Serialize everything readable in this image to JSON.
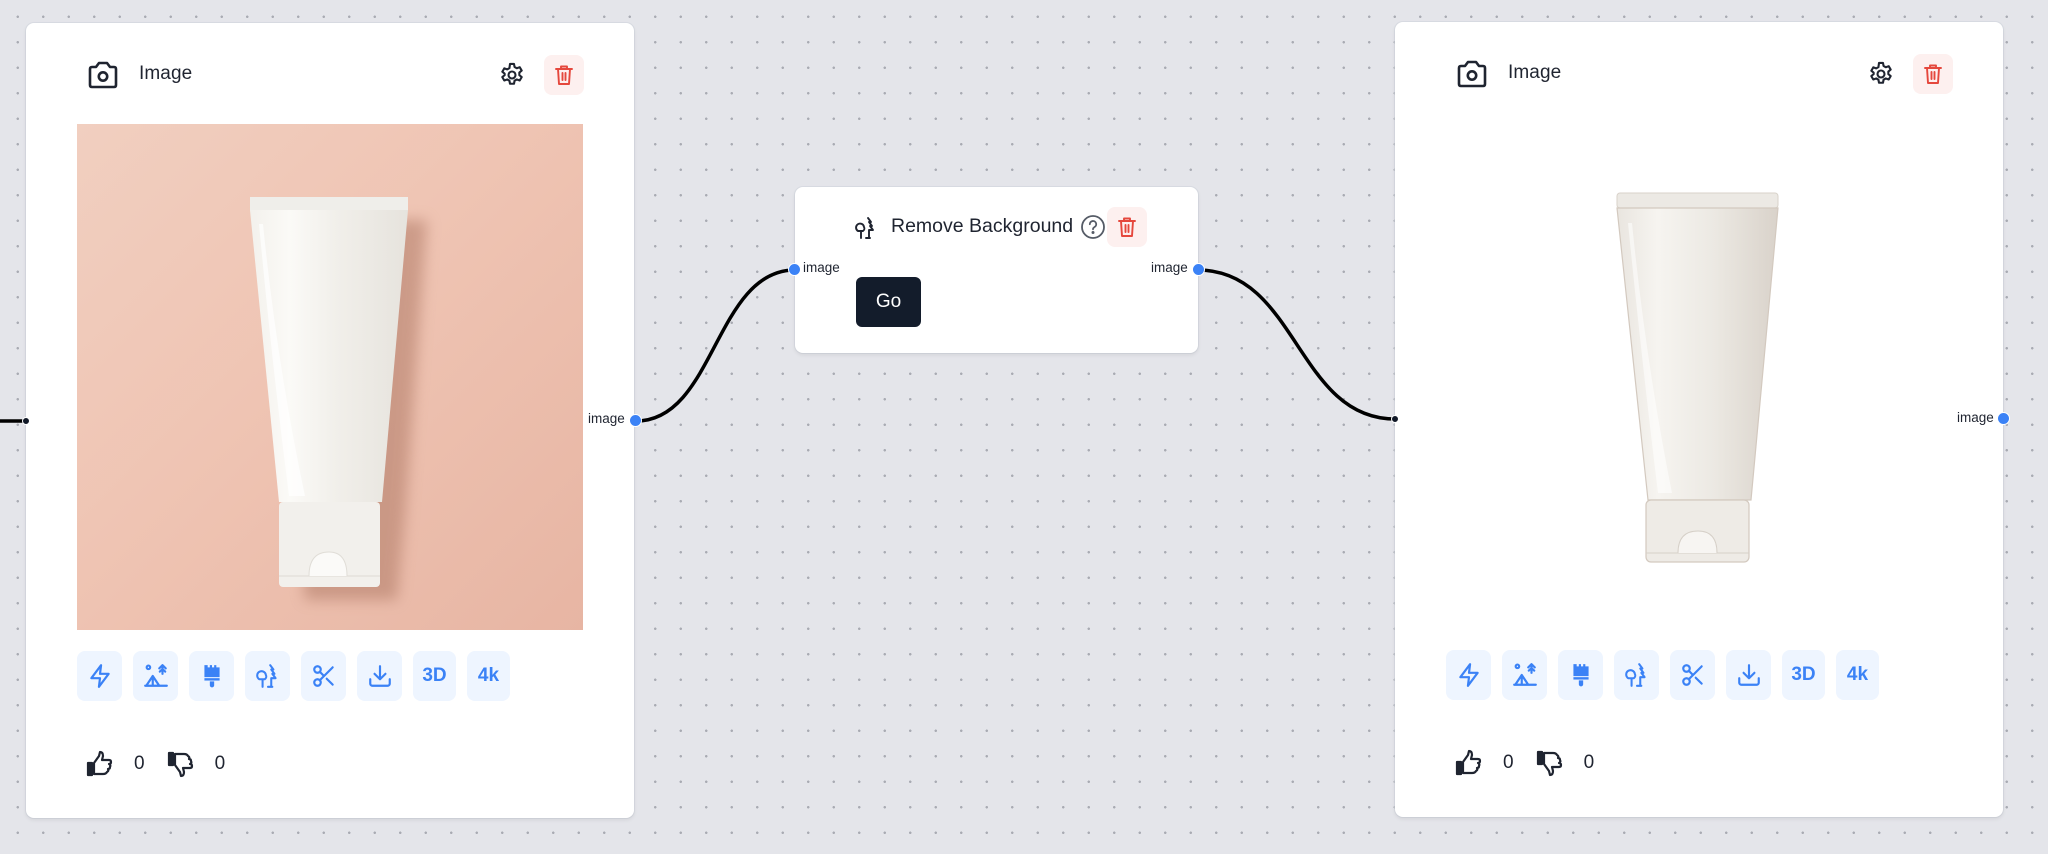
{
  "colors": {
    "canvas_bg": "#e4e5ea",
    "accent": "#3b82f6",
    "danger": "#e5483d",
    "danger_bg": "#fdf0ef",
    "toolbar_bg": "#eef5ff",
    "dark_button": "#131c2b",
    "edge": "#000000"
  },
  "nodes": {
    "input_image": {
      "title": "Image",
      "header_icon": "camera-icon",
      "settings_icon": "gear-icon",
      "delete_icon": "trash-icon",
      "image_description": "White cosmetic squeeze tube on peach background",
      "toolbar": [
        {
          "icon": "zap-icon",
          "label": ""
        },
        {
          "icon": "scene-icon",
          "label": ""
        },
        {
          "icon": "brush-icon",
          "label": ""
        },
        {
          "icon": "trees-icon",
          "label": ""
        },
        {
          "icon": "scissors-icon",
          "label": ""
        },
        {
          "icon": "download-icon",
          "label": ""
        },
        {
          "icon": "text",
          "label": "3D"
        },
        {
          "icon": "text",
          "label": "4k"
        }
      ],
      "likes": "0",
      "dislikes": "0",
      "output_label": "image"
    },
    "remove_background": {
      "title": "Remove Background",
      "icon": "trees-icon",
      "help_icon": "help-circle-icon",
      "delete_icon": "trash-icon",
      "go_label": "Go",
      "input_label": "image",
      "output_label": "image"
    },
    "output_image": {
      "title": "Image",
      "header_icon": "camera-icon",
      "settings_icon": "gear-icon",
      "delete_icon": "trash-icon",
      "image_description": "White cosmetic squeeze tube with background removed",
      "toolbar": [
        {
          "icon": "zap-icon",
          "label": ""
        },
        {
          "icon": "scene-icon",
          "label": ""
        },
        {
          "icon": "brush-icon",
          "label": ""
        },
        {
          "icon": "trees-icon",
          "label": ""
        },
        {
          "icon": "scissors-icon",
          "label": ""
        },
        {
          "icon": "download-icon",
          "label": ""
        },
        {
          "icon": "text",
          "label": "3D"
        },
        {
          "icon": "text",
          "label": "4k"
        }
      ],
      "likes": "0",
      "dislikes": "0",
      "output_label": "image"
    }
  },
  "edges": [
    {
      "from": "input_image.image",
      "to": "remove_background.image"
    },
    {
      "from": "remove_background.image",
      "to": "output_image.image"
    },
    {
      "from": "offscreen",
      "to": "input_image.input"
    }
  ]
}
